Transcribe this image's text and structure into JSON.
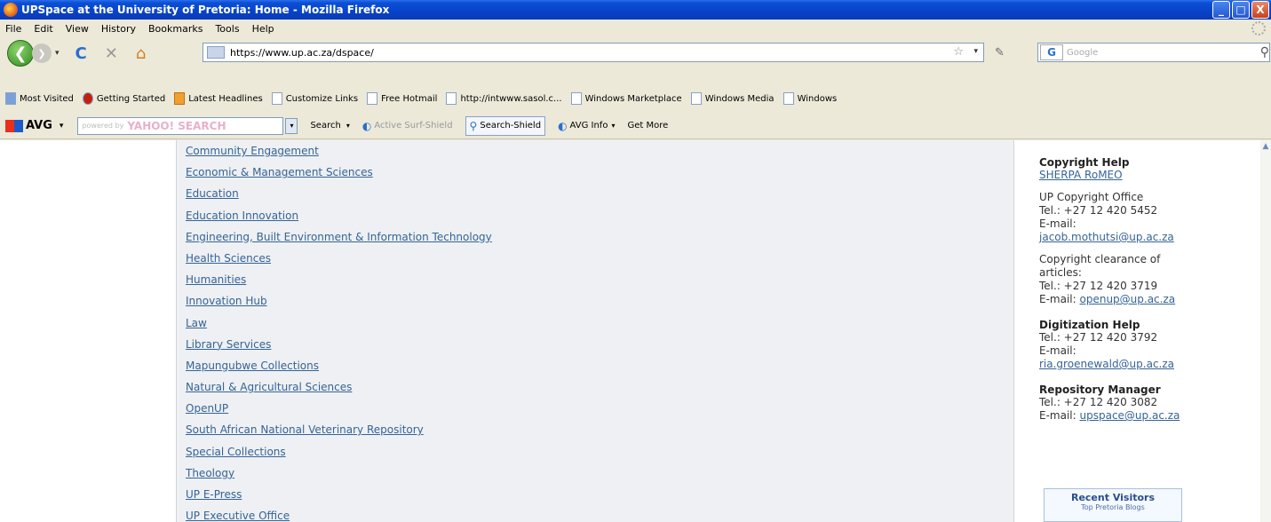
{
  "window": {
    "title": "UPSpace at the University of Pretoria: Home - Mozilla Firefox",
    "minimize_label": "_",
    "maximize_label": "□",
    "close_label": "X"
  },
  "menu": [
    "File",
    "Edit",
    "View",
    "History",
    "Bookmarks",
    "Tools",
    "Help"
  ],
  "nav": {
    "url": "https://www.up.ac.za/dspace/",
    "search_placeholder": "Google",
    "back_glyph": "❮",
    "forward_glyph": "❯",
    "dropdown_glyph": "▾",
    "reload_glyph": "C",
    "stop_glyph": "✕",
    "home_glyph": "⌂",
    "star_glyph": "☆",
    "addon_glyph": "✎",
    "search_engine_glyph": "G",
    "search_glyph": "⚲"
  },
  "bookmarks": [
    {
      "label": "Most Visited",
      "icon": "mv"
    },
    {
      "label": "Getting Started",
      "icon": "gs"
    },
    {
      "label": "Latest Headlines",
      "icon": "rss"
    },
    {
      "label": "Customize Links",
      "icon": "page"
    },
    {
      "label": "Free Hotmail",
      "icon": "page"
    },
    {
      "label": "http://intwww.sasol.c...",
      "icon": "page"
    },
    {
      "label": "Windows Marketplace",
      "icon": "page"
    },
    {
      "label": "Windows Media",
      "icon": "page"
    },
    {
      "label": "Windows",
      "icon": "page"
    }
  ],
  "avg": {
    "logo": "AVG",
    "search_hint": "powered by",
    "search_brand": "YAHOO! SEARCH",
    "search_label": "Search",
    "surf_shield": "Active Surf-Shield",
    "search_shield": "Search-Shield",
    "info": "AVG Info",
    "get_more": "Get More"
  },
  "communities": [
    "Community Engagement",
    "Economic & Management Sciences",
    "Education",
    "Education Innovation",
    "Engineering, Built Environment & Information Technology",
    "Health Sciences",
    "Humanities",
    "Innovation Hub",
    "Law",
    "Library Services",
    "Mapungubwe Collections",
    "Natural & Agricultural Sciences",
    "OpenUP",
    "South African National Veterinary Repository",
    "Special Collections",
    "Theology",
    "UP E-Press",
    "UP Executive Office"
  ],
  "sidebar": {
    "copyright_heading": "Copyright Help",
    "sherpa_link": "SHERPA RoMEO",
    "copyright_office": "UP Copyright Office",
    "copyright_tel": "Tel.: +27 12 420 5452",
    "email_label": "E-mail:",
    "copyright_email": "jacob.mothutsi@up.ac.za",
    "clearance_line1": "Copyright clearance of",
    "clearance_line2": "articles:",
    "clearance_tel": "Tel.: +27 12 420 3719",
    "clearance_email_label": "E-mail:",
    "clearance_email": "openup@up.ac.za",
    "digitization_heading": "Digitization Help",
    "digitization_tel": "Tel.: +27 12 420 3792",
    "digitization_email_label": "E-mail:",
    "digitization_email": "ria.groenewald@up.ac.za",
    "repo_heading": "Repository Manager",
    "repo_tel": "Tel.: +27 12 420 3082",
    "repo_email_label": "E-mail:",
    "repo_email": "upspace@up.ac.za",
    "visitors_title": "Recent Visitors",
    "visitors_sub": "Top Pretoria Blogs"
  }
}
